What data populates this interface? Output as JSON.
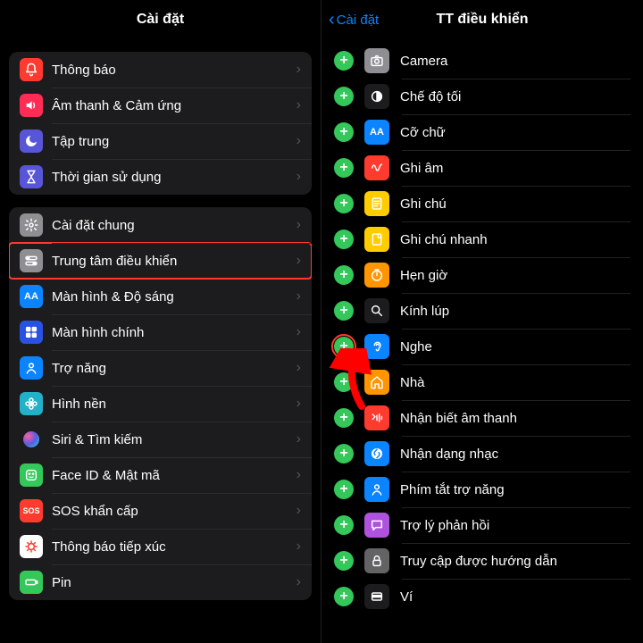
{
  "left": {
    "title": "Cài đặt",
    "group1": [
      {
        "icon": "bell-icon",
        "bg": "#ff3b30",
        "glyph": "bell",
        "label": "Thông báo"
      },
      {
        "icon": "sound-icon",
        "bg": "#ff2d55",
        "glyph": "speaker",
        "label": "Âm thanh & Cảm ứng"
      },
      {
        "icon": "focus-icon",
        "bg": "#5856d6",
        "glyph": "moon",
        "label": "Tập trung"
      },
      {
        "icon": "screentime-icon",
        "bg": "#5856d6",
        "glyph": "hourglass",
        "label": "Thời gian sử dụng"
      }
    ],
    "group2": [
      {
        "icon": "general-icon",
        "bg": "#8e8e93",
        "glyph": "gear",
        "label": "Cài đặt chung",
        "hl": false
      },
      {
        "icon": "control-center-icon",
        "bg": "#8e8e93",
        "glyph": "toggles",
        "label": "Trung tâm điều khiển",
        "hl": true
      },
      {
        "icon": "display-icon",
        "bg": "#0a84ff",
        "glyph": "AA",
        "label": "Màn hình & Độ sáng"
      },
      {
        "icon": "home-icon",
        "bg": "#2952e3",
        "glyph": "grid",
        "label": "Màn hình chính"
      },
      {
        "icon": "accessibility-icon",
        "bg": "#0a84ff",
        "glyph": "person",
        "label": "Trợ năng"
      },
      {
        "icon": "wallpaper-icon",
        "bg": "#23b0c9",
        "glyph": "flower",
        "label": "Hình nền"
      },
      {
        "icon": "siri-icon",
        "bg": "#1c1c1e",
        "glyph": "siri",
        "label": "Siri & Tìm kiếm"
      },
      {
        "icon": "faceid-icon",
        "bg": "#34c759",
        "glyph": "face",
        "label": "Face ID & Mật mã"
      },
      {
        "icon": "sos-icon",
        "bg": "#ff3b30",
        "glyph": "SOS",
        "label": "SOS khẩn cấp"
      },
      {
        "icon": "exposure-icon",
        "bg": "#ffffff",
        "glyph": "virus",
        "label": "Thông báo tiếp xúc"
      },
      {
        "icon": "battery-icon",
        "bg": "#34c759",
        "glyph": "battery",
        "label": "Pin"
      }
    ]
  },
  "right": {
    "back": "Cài đặt",
    "title": "TT điều khiển",
    "items": [
      {
        "icon": "camera-icon",
        "bg": "#8e8e93",
        "glyph": "camera",
        "label": "Camera"
      },
      {
        "icon": "darkmode-icon",
        "bg": "#1c1c1e",
        "glyph": "darkmode",
        "label": "Chế độ tối"
      },
      {
        "icon": "textsize-icon",
        "bg": "#0a84ff",
        "glyph": "AA",
        "label": "Cỡ chữ"
      },
      {
        "icon": "voice-memo-icon",
        "bg": "#ff3b30",
        "glyph": "wave",
        "label": "Ghi âm"
      },
      {
        "icon": "notes-icon",
        "bg": "#ffcc00",
        "glyph": "note",
        "label": "Ghi chú"
      },
      {
        "icon": "quicknote-icon",
        "bg": "#ffcc00",
        "glyph": "qnote",
        "label": "Ghi chú nhanh"
      },
      {
        "icon": "timer-icon",
        "bg": "#ff9500",
        "glyph": "timer",
        "label": "Hẹn giờ"
      },
      {
        "icon": "magnifier-icon",
        "bg": "#1c1c1e",
        "glyph": "search",
        "label": "Kính lúp"
      },
      {
        "icon": "hearing-icon",
        "bg": "#0a84ff",
        "glyph": "ear",
        "label": "Nghe",
        "hl": true
      },
      {
        "icon": "home-app-icon",
        "bg": "#ff9500",
        "glyph": "house",
        "label": "Nhà"
      },
      {
        "icon": "soundrecog-icon",
        "bg": "#ff3b30",
        "glyph": "soundwave",
        "label": "Nhận biết âm thanh"
      },
      {
        "icon": "shazam-icon",
        "bg": "#0a84ff",
        "glyph": "shazam",
        "label": "Nhận dạng nhạc"
      },
      {
        "icon": "shortcut-icon",
        "bg": "#0a84ff",
        "glyph": "person",
        "label": "Phím tắt trợ năng"
      },
      {
        "icon": "feedback-icon",
        "bg": "#af52de",
        "glyph": "bubble",
        "label": "Trợ lý phản hồi"
      },
      {
        "icon": "guided-icon",
        "bg": "#636366",
        "glyph": "lock",
        "label": "Truy cập được hướng dẫn"
      },
      {
        "icon": "wallet-icon",
        "bg": "#1c1c1e",
        "glyph": "wallet",
        "label": "Ví"
      }
    ]
  }
}
